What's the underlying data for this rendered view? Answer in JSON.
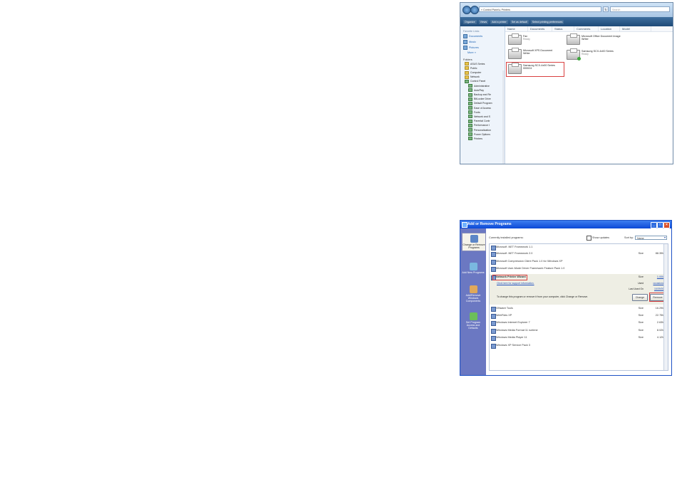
{
  "vista": {
    "address": "« Control Panel ▸ Printers",
    "search_placeholder": "Search",
    "toolbar": [
      "Organize",
      "Views",
      "Add a printer",
      "Set as default",
      "Select printing preferences"
    ],
    "favorite_links_title": "Favorite Links",
    "favorite_links": [
      "Documents",
      "Music",
      "Pictures",
      "More »"
    ],
    "folders_title": "Folders",
    "folder_tree": [
      "ASUS Series",
      "Public",
      "Computer",
      "Network",
      "Control Panel",
      "Administrative",
      "AutoPlay",
      "Backup and Re",
      "BitLocker Drive",
      "Default Program",
      "Ease of Access",
      "Fonts",
      "Network and S",
      "Parental Contr",
      "Performance I",
      "Personalization",
      "Power Options",
      "Printers"
    ],
    "columns": [
      "Name",
      "Documents",
      "Status",
      "Comments",
      "Location",
      "Model"
    ],
    "printers": [
      {
        "name": "Fax",
        "status": "Ready"
      },
      {
        "name": "Microsoft Office Document Image Writer",
        "status": ""
      },
      {
        "name": "Microsoft XPS Document Writer",
        "status": ""
      },
      {
        "name": "Samsung SCX-4x00 Series",
        "status": "Ready"
      },
      {
        "name": "Samsung SCX-4x00 Series 000024",
        "status": ""
      }
    ]
  },
  "xp": {
    "title": "Add or Remove Programs",
    "sidebar": [
      "Change or Remove Programs",
      "Add New Programs",
      "Add/Remove Windows Components",
      "Set Program Access and Defaults"
    ],
    "currently_installed": "Currently installed programs:",
    "show_updates": "Show updates",
    "sort_by": "Sort by:",
    "sort_value": "Name",
    "programs": [
      {
        "name": "Microsoft .NET Framework 1.1",
        "size": ""
      },
      {
        "name": "Microsoft .NET Framework 2.0",
        "size": "88.39MB"
      },
      {
        "name": "Microsoft Compression Client Pack 1.0 for Windows XP",
        "size": ""
      },
      {
        "name": "Microsoft User-Mode Driver Framework Feature Pack 1.0",
        "size": ""
      },
      {
        "name": "Network Printer Wizard",
        "size": "1.00MB"
      },
      {
        "name": "VMware Tools",
        "size": "16.29MB"
      },
      {
        "name": "WebFldrs XP",
        "size": "22.75MB"
      },
      {
        "name": "Windows Internet Explorer 7",
        "size": "2.63MB"
      },
      {
        "name": "Windows Media Format 11 runtime",
        "size": "8.02MB"
      },
      {
        "name": "Windows Media Player 11",
        "size": "4.12MB"
      },
      {
        "name": "Windows XP Service Pack 3",
        "size": ""
      }
    ],
    "size_label": "Size",
    "used_label": "Used",
    "used_value": "occasionally",
    "last_used_label": "Last Used On",
    "last_used_value": "10/29/2008",
    "support_link": "Click here for support information.",
    "change_msg": "To change this program or remove it from your computer, click Change or Remove.",
    "change_btn": "Change",
    "remove_btn": "Remove"
  }
}
